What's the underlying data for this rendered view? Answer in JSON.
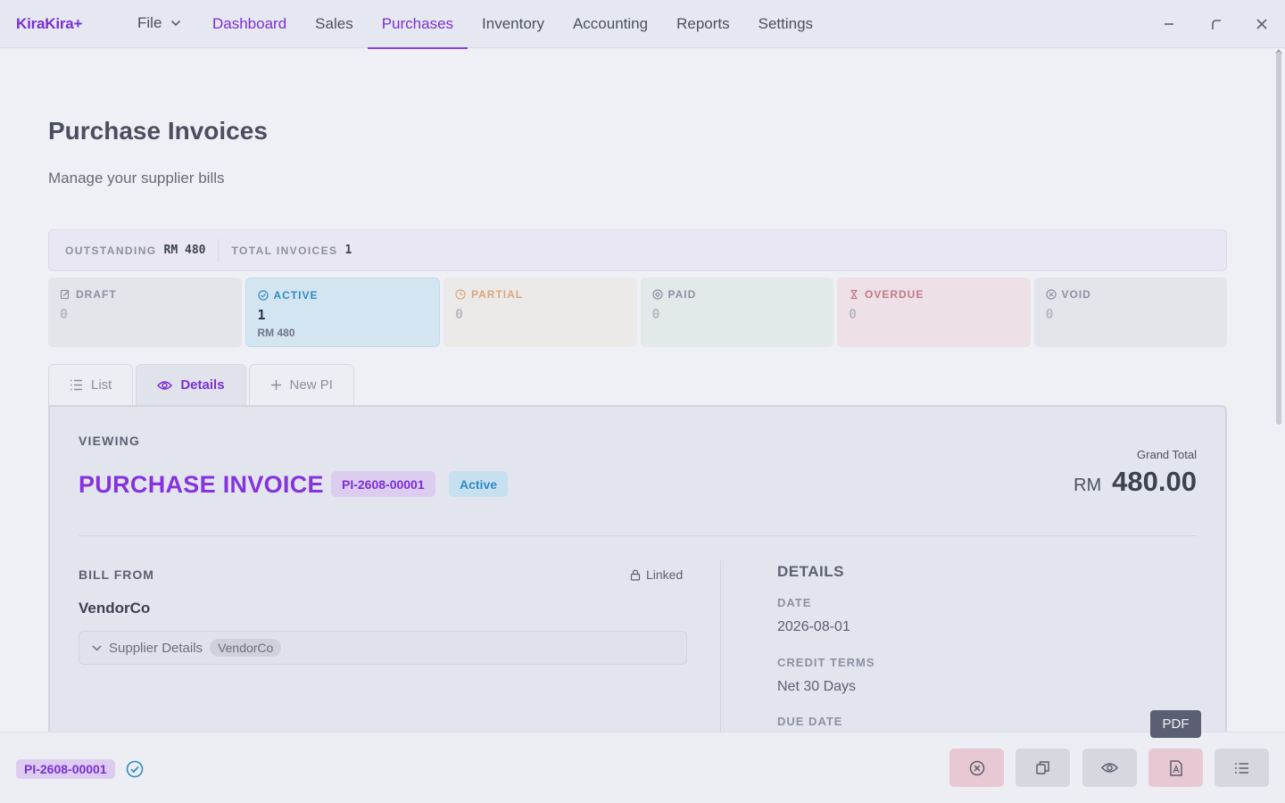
{
  "app": {
    "logo": "KiraKira+",
    "file_menu": "File"
  },
  "nav": [
    {
      "label": "Dashboard"
    },
    {
      "label": "Sales"
    },
    {
      "label": "Purchases"
    },
    {
      "label": "Inventory"
    },
    {
      "label": "Accounting"
    },
    {
      "label": "Reports"
    },
    {
      "label": "Settings"
    }
  ],
  "page": {
    "title": "Purchase Invoices",
    "subtitle": "Manage your supplier bills"
  },
  "summary": {
    "outstanding_label": "OUTSTANDING",
    "outstanding_value": "RM 480",
    "total_label": "TOTAL INVOICES",
    "total_value": "1"
  },
  "status_cards": {
    "draft": {
      "label": "DRAFT",
      "count": "0"
    },
    "active": {
      "label": "ACTIVE",
      "count": "1",
      "amount": "RM 480"
    },
    "partial": {
      "label": "PARTIAL",
      "count": "0"
    },
    "paid": {
      "label": "PAID",
      "count": "0"
    },
    "overdue": {
      "label": "OVERDUE",
      "count": "0"
    },
    "void": {
      "label": "VOID",
      "count": "0"
    }
  },
  "tabs": {
    "list": "List",
    "details": "Details",
    "new": "New PI"
  },
  "detail": {
    "viewing_label": "VIEWING",
    "doc_title": "PURCHASE INVOICE",
    "doc_number": "PI-2608-00001",
    "status": "Active",
    "grand_total_label": "Grand Total",
    "currency": "RM",
    "grand_total": "480.00",
    "bill_from_label": "BILL FROM",
    "linked_label": "Linked",
    "vendor_name": "VendorCo",
    "supplier_details_label": "Supplier Details",
    "supplier_chip": "VendorCo",
    "details_heading": "DETAILS",
    "date_label": "DATE",
    "date_value": "2026-08-01",
    "credit_terms_label": "CREDIT TERMS",
    "credit_terms_value": "Net 30 Days",
    "due_date_label": "DUE DATE"
  },
  "bottom": {
    "doc_chip": "PI-2608-00001",
    "pdf_tooltip": "PDF"
  },
  "colors": {
    "accent": "#7b2fd6",
    "active_blue": "#2f8bc4",
    "danger_pink": "#e8c9d3"
  }
}
